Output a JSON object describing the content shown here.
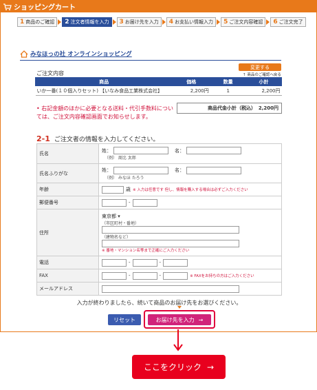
{
  "header": {
    "title": "ショッピングカート"
  },
  "steps": [
    {
      "num": "1",
      "label": "商品のご確認"
    },
    {
      "num": "2",
      "label": "注文者情報を入力"
    },
    {
      "num": "3",
      "label": "お届け先を入力"
    },
    {
      "num": "4",
      "label": "お支払い情報入力"
    },
    {
      "num": "5",
      "label": "ご注文内容確認"
    },
    {
      "num": "6",
      "label": "ご注文完了"
    }
  ],
  "shop": {
    "name": "みなほっの社 オンラインショッピング"
  },
  "order": {
    "label": "ご注文内容",
    "change_button": "変更する",
    "change_note": "↑ 商品のご確認へ戻る",
    "headers": [
      "商品",
      "価格",
      "数量",
      "小計"
    ],
    "rows": [
      {
        "product": "いか一番(１０個入りセット) 【いなみ食品工業株式会社】",
        "price": "2,200円",
        "qty": "1",
        "subtotal": "2,200円"
      }
    ],
    "notice": "右記金額のほかに必要となる送料・代引手数料については、ご注文内容確認画面でお知らせします。",
    "subtotal_label": "商品代金小計（税込）",
    "subtotal_value": "2,200円"
  },
  "form": {
    "section_num": "2-1",
    "section_title": "ご注文者の情報を入力してください。",
    "name": {
      "label": "氏名",
      "sei": "姓：",
      "mei": "名：",
      "example": "（例） 周比 太郎"
    },
    "kana": {
      "label": "氏名ふりがな",
      "sei": "姓：",
      "mei": "名：",
      "example": "（例） みなほ たろう"
    },
    "age": {
      "label": "年齢",
      "unit": "歳",
      "note": "※ 入力は任意です 但し、情報を購入する場合は必ずご入力ください"
    },
    "postal": {
      "label": "郵便番号",
      "sep": "-"
    },
    "address": {
      "label": "住所",
      "prefecture": "東京都",
      "city_hint": "（市区町村・番地）",
      "building_hint": "（建物名など）",
      "note": "※ 番地・マンション名等まで正確にご入力ください"
    },
    "phone": {
      "label": "電話",
      "sep": "-"
    },
    "fax": {
      "label": "FAX",
      "sep": "-",
      "note": "※ FAXをお持ちの方はご入力ください"
    },
    "email": {
      "label": "メールアドレス"
    }
  },
  "actions": {
    "instruction": "入力が終わりましたら、続いて商品のお届け先をお選びください。",
    "reset": "リセット",
    "next": "お届け先を入力",
    "next_arrow": "→",
    "callout": "ここをクリック",
    "callout_arrow": "→"
  },
  "colors": {
    "accent": "#e8791a",
    "navy": "#2a4e9a",
    "highlight": "#e0003a",
    "notice": "#d0103a"
  }
}
